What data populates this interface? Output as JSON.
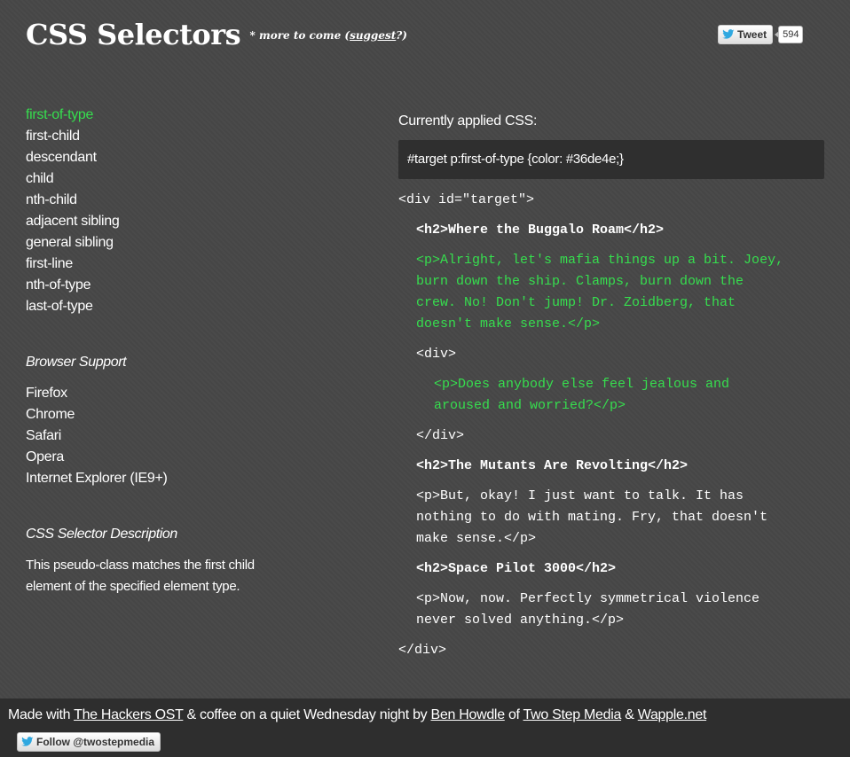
{
  "header": {
    "title": "CSS Selectors",
    "tagline_prefix": "* more to come (",
    "suggest_link": "suggest",
    "tagline_suffix": "?)",
    "tweet_label": "Tweet",
    "tweet_count": "594"
  },
  "selectors": {
    "items": [
      "first-of-type",
      "first-child",
      "descendant",
      "child",
      "nth-child",
      "adjacent sibling",
      "general sibling",
      "first-line",
      "nth-of-type",
      "last-of-type"
    ],
    "active_index": 0
  },
  "browser_support": {
    "heading": "Browser Support",
    "items": [
      "Firefox",
      "Chrome",
      "Safari",
      "Opera",
      "Internet Explorer (IE9+)"
    ]
  },
  "description": {
    "heading": "CSS Selector Description",
    "text": "This pseudo-class matches the first child element of the specified element type."
  },
  "applied": {
    "label": "Currently applied CSS:",
    "css": "#target p:first-of-type {color: #36de4e;}"
  },
  "code": {
    "open_div": "<div id=\"target\">",
    "h2_1": "<h2>Where the Buggalo Roam</h2>",
    "p1_lines": [
      "<p>Alright, let's mafia things up a bit. Joey,",
      "burn down the ship. Clamps, burn down the",
      "crew. No! Don't jump! Dr. Zoidberg, that",
      "doesn't make sense.</p>"
    ],
    "inner_open": "<div>",
    "p2_lines": [
      "<p>Does anybody else feel jealous and",
      "aroused and worried?</p>"
    ],
    "inner_close": "</div>",
    "h2_2": "<h2>The Mutants Are Revolting</h2>",
    "p3_lines": [
      "<p>But, okay! I just want to talk. It has",
      "nothing to do with mating. Fry, that doesn't",
      "make sense.</p>"
    ],
    "h2_3": "<h2>Space Pilot 3000</h2>",
    "p4_lines": [
      "<p>Now, now. Perfectly symmetrical violence",
      "never solved anything.</p>"
    ],
    "close_div": "</div>"
  },
  "footer": {
    "t1": "Made with ",
    "link1": "The Hackers OST",
    "t2": " & coffee on a quiet Wednesday night by ",
    "link2": "Ben Howdle",
    "t3": " of ",
    "link3": "Two Step Media",
    "t4": " & ",
    "link4": "Wapple.net",
    "follow_label": "Follow @twostepmedia"
  },
  "colors": {
    "accent": "#36de4e",
    "background": "#474747",
    "footer": "#2e2e2e",
    "box": "#2f2f2f"
  }
}
